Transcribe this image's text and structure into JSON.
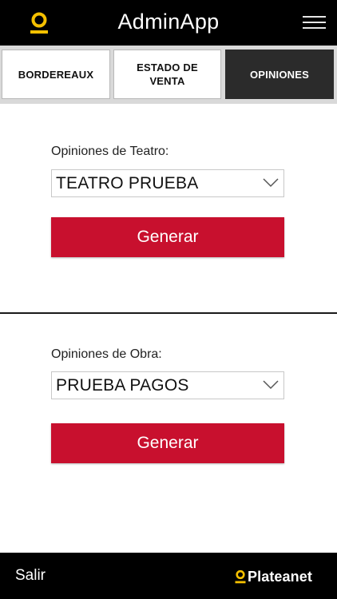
{
  "header": {
    "title": "AdminApp",
    "logo_icon": "platea-logo-icon",
    "menu_icon": "hamburger-menu-icon"
  },
  "tabs": [
    {
      "label": "BORDEREAUX",
      "active": false
    },
    {
      "label": "ESTADO DE VENTA",
      "active": false
    },
    {
      "label": "OPINIONES",
      "active": true
    }
  ],
  "theater_opinions": {
    "label": "Opiniones de Teatro:",
    "selected": "TEATRO PRUEBA",
    "button_label": "Generar"
  },
  "play_opinions": {
    "label": "Opiniones de Obra:",
    "selected": "PRUEBA PAGOS",
    "button_label": "Generar"
  },
  "footer": {
    "exit_label": "Salir",
    "brand": "Plateanet"
  },
  "colors": {
    "accent": "#c8102e",
    "brand_yellow": "#f5c000",
    "active_tab": "#2b2b2b"
  }
}
